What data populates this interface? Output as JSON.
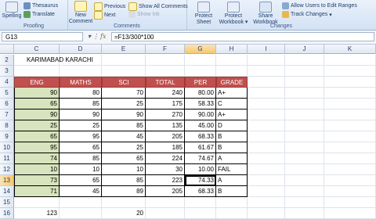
{
  "ribbon": {
    "proofing": {
      "title": "Proofing",
      "spelling": "Spelling",
      "thesaurus": "Thesaurus",
      "translate": "Translate"
    },
    "comments": {
      "title": "Comments",
      "new_comment": "New\nComment",
      "previous": "Previous",
      "next": "Next",
      "show_all": "Show All Comments",
      "show_ink": "Show Ink"
    },
    "changes": {
      "title": "Changes",
      "protect_sheet": "Protect\nSheet",
      "protect_workbook": "Protect\nWorkbook",
      "share_workbook": "Share\nWorkbook",
      "allow_users": "Allow Users to Edit Ranges",
      "track_changes": "Track Changes"
    }
  },
  "formula_bar": {
    "name_box": "G13",
    "fx_label": "fx",
    "formula": "=F13/300*100"
  },
  "columns": [
    "C",
    "D",
    "E",
    "F",
    "G",
    "H",
    "I",
    "J",
    "K"
  ],
  "rows": [
    "2",
    "3",
    "4",
    "5",
    "6",
    "7",
    "8",
    "9",
    "10",
    "11",
    "12",
    "13",
    "14",
    "15",
    "16"
  ],
  "sheet": {
    "title": "KARIMABAD KARACHI",
    "headers": [
      "ENG",
      "MATHS",
      "SCI",
      "TOTAL",
      "PER",
      "GRADE"
    ],
    "data": [
      [
        "90",
        "80",
        "70",
        "240",
        "80.00",
        "A+"
      ],
      [
        "65",
        "85",
        "25",
        "175",
        "58.33",
        "C"
      ],
      [
        "90",
        "90",
        "90",
        "270",
        "90.00",
        "A+"
      ],
      [
        "25",
        "25",
        "85",
        "135",
        "45.00",
        "D"
      ],
      [
        "65",
        "95",
        "45",
        "205",
        "68.33",
        "B"
      ],
      [
        "95",
        "65",
        "25",
        "185",
        "61.67",
        "B"
      ],
      [
        "74",
        "85",
        "65",
        "224",
        "74.67",
        "A"
      ],
      [
        "10",
        "10",
        "10",
        "30",
        "10.00",
        "FAIL"
      ],
      [
        "73",
        "65",
        "85",
        "223",
        "74.33",
        "A"
      ],
      [
        "71",
        "45",
        "89",
        "205",
        "68.33",
        "B"
      ]
    ],
    "footer_c": "123",
    "footer_e": "20"
  }
}
